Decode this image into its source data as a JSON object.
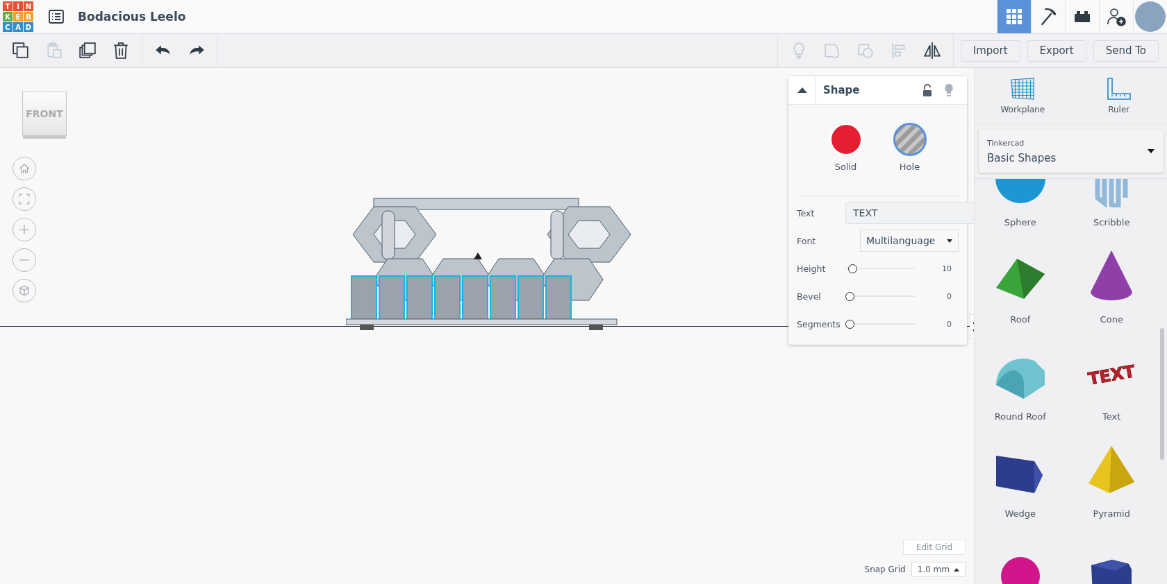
{
  "header": {
    "logo": [
      {
        "letter": "T",
        "color": "#e8502f"
      },
      {
        "letter": "I",
        "color": "#e8502f"
      },
      {
        "letter": "N",
        "color": "#e8502f"
      },
      {
        "letter": "K",
        "color": "#5bb04a"
      },
      {
        "letter": "E",
        "color": "#f0a42b"
      },
      {
        "letter": "R",
        "color": "#f0a42b"
      },
      {
        "letter": "C",
        "color": "#2e8fd0"
      },
      {
        "letter": "A",
        "color": "#2e8fd0"
      },
      {
        "letter": "D",
        "color": "#2e8fd0"
      }
    ],
    "title": "Bodacious Leelo",
    "nav": [
      {
        "kind": "grid",
        "selected": true
      },
      {
        "kind": "pickaxe",
        "selected": false
      },
      {
        "kind": "bricks",
        "selected": false
      },
      {
        "kind": "adduser",
        "selected": false
      },
      {
        "kind": "avatar",
        "selected": false
      }
    ]
  },
  "toolbar": {
    "left": [
      {
        "kind": "copy",
        "disabled": false
      },
      {
        "kind": "paste",
        "disabled": true
      },
      {
        "kind": "duplicate",
        "disabled": false
      },
      {
        "kind": "delete",
        "disabled": false
      },
      {
        "kind": "undo",
        "disabled": false
      },
      {
        "kind": "redo",
        "disabled": false
      }
    ],
    "right": [
      {
        "kind": "bulb",
        "disabled": true
      },
      {
        "kind": "group",
        "disabled": true
      },
      {
        "kind": "ungroup",
        "disabled": true
      },
      {
        "kind": "align",
        "disabled": true
      },
      {
        "kind": "mirror",
        "disabled": false
      }
    ],
    "buttons": [
      "Import",
      "Export",
      "Send To"
    ]
  },
  "canvas": {
    "view_cube": "FRONT",
    "nav": [
      {
        "kind": "home"
      },
      {
        "kind": "fit"
      },
      {
        "kind": "zoomin"
      },
      {
        "kind": "zoomout"
      },
      {
        "kind": "ortho"
      }
    ],
    "edit_grid": "Edit Grid",
    "snap_grid": {
      "label": "Snap Grid",
      "value": "1.0 mm"
    }
  },
  "shape_panel": {
    "title": "Shape",
    "modes": [
      {
        "label": "Solid",
        "kind": "solid",
        "selected": false
      },
      {
        "label": "Hole",
        "kind": "hole",
        "selected": true
      }
    ],
    "text_field": {
      "label": "Text",
      "value": "TEXT"
    },
    "font": {
      "label": "Font",
      "value": "Multilanguage"
    },
    "sliders": [
      {
        "label": "Height",
        "level": 0.05,
        "reading": "10"
      },
      {
        "label": "Bevel",
        "level": 0,
        "reading": "0"
      },
      {
        "label": "Segments",
        "level": 0,
        "reading": "0"
      }
    ]
  },
  "sidebar": {
    "tools": [
      {
        "kind": "workplane",
        "label": "Workplane"
      },
      {
        "kind": "ruler",
        "label": "Ruler"
      }
    ],
    "library": {
      "caption": "Tinkercad",
      "value": "Basic Shapes"
    },
    "shapes": [
      {
        "kind": "sphere",
        "label": "Sphere"
      },
      {
        "kind": "scribble",
        "label": "Scribble"
      },
      {
        "kind": "roof",
        "label": "Roof"
      },
      {
        "kind": "cone",
        "label": "Cone"
      },
      {
        "kind": "roundroof",
        "label": "Round Roof"
      },
      {
        "kind": "text",
        "label": "Text",
        "glyph": "TEXT"
      },
      {
        "kind": "wedge",
        "label": "Wedge"
      },
      {
        "kind": "pyramid",
        "label": "Pyramid"
      },
      {
        "kind": "ball"
      },
      {
        "kind": "polygon"
      }
    ]
  }
}
